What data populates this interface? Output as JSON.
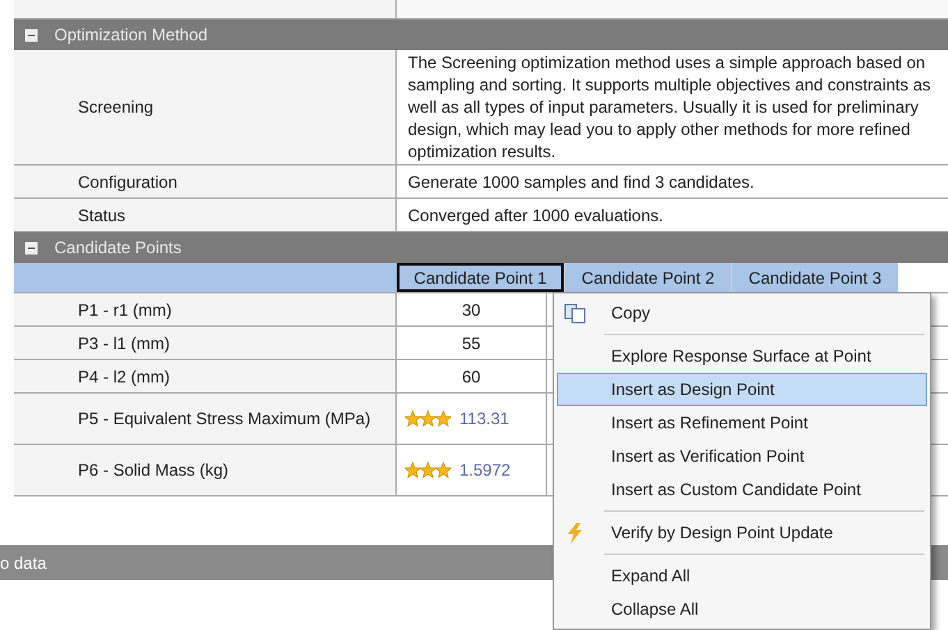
{
  "sections": [
    {
      "title": "Optimization Method",
      "expanded": true,
      "rows": [
        {
          "label": "Screening",
          "value": "The Screening optimization method uses a simple approach based on sampling and sorting. It supports multiple objectives and constraints as well as all types of input parameters. Usually it is used for preliminary design, which may lead you to apply other methods for more refined optimization results."
        },
        {
          "label": "Configuration",
          "value": "Generate 1000 samples and find 3 candidates."
        },
        {
          "label": "Status",
          "value": "Converged after 1000 evaluations."
        }
      ]
    },
    {
      "title": "Candidate Points",
      "expanded": true,
      "columns": [
        {
          "label": "Candidate Point 1",
          "selected": true
        },
        {
          "label": "Candidate Point 2",
          "selected": false
        },
        {
          "label": "Candidate Point 3",
          "selected": false
        }
      ],
      "rows": [
        {
          "label": "P1 - r1 (mm)",
          "value": "30"
        },
        {
          "label": "P3 - l1 (mm)",
          "value": "55"
        },
        {
          "label": "P4 - l2 (mm)",
          "value": "60"
        },
        {
          "label": "P5 - Equivalent Stress Maximum (MPa)",
          "value": "113.31",
          "stars": 3
        },
        {
          "label": "P6 - Solid Mass (kg)",
          "value": "1.5972",
          "stars": 3
        }
      ]
    }
  ],
  "status_bar": "o data",
  "context_menu": [
    {
      "kind": "copy",
      "label": "Copy",
      "selected": false
    },
    {
      "kind": "separator"
    },
    {
      "label": "Explore Response Surface at Point",
      "selected": false
    },
    {
      "label": "Insert as Design Point",
      "selected": true
    },
    {
      "label": "Insert as Refinement Point",
      "selected": false
    },
    {
      "label": "Insert as Verification Point",
      "selected": false
    },
    {
      "label": "Insert as Custom Candidate Point",
      "selected": false
    },
    {
      "kind": "separator"
    },
    {
      "kind": "lightning",
      "label": "Verify by Design Point Update",
      "selected": false
    },
    {
      "kind": "separator"
    },
    {
      "label": "Expand All",
      "selected": false
    },
    {
      "label": "Collapse All",
      "selected": false
    }
  ]
}
